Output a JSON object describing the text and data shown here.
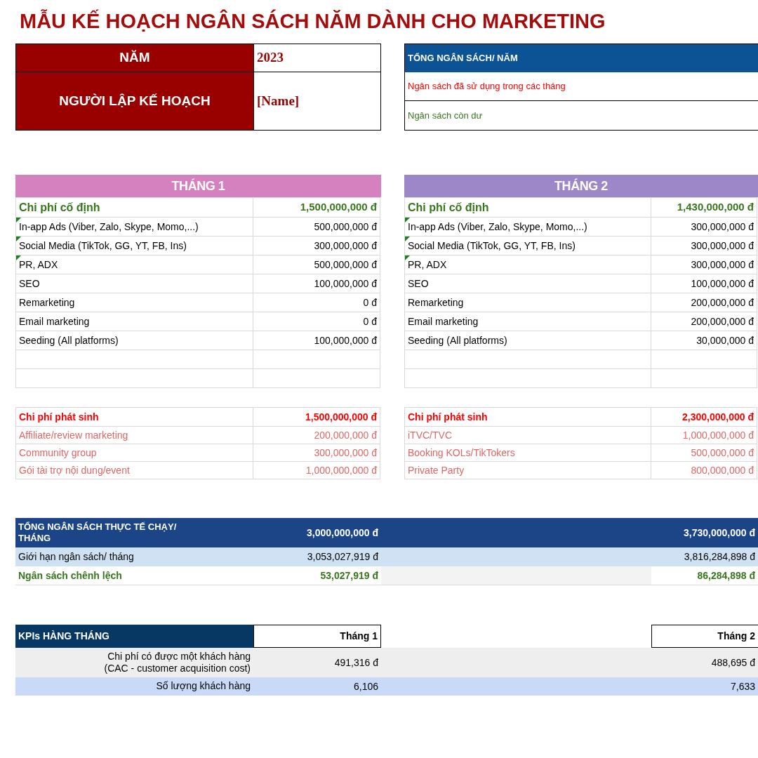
{
  "title": "MẪU KẾ HOẠCH NGÂN SÁCH NĂM DÀNH CHO MARKETING",
  "info": {
    "year_label": "NĂM",
    "year": "2023",
    "planner_label": "NGƯỜI LẬP KẾ HOẠCH",
    "planner": "[Name]"
  },
  "budget_summary": {
    "header": "TỔNG NGÂN SÁCH/ NĂM",
    "used_label": "Ngân sách đã sử dụng trong các tháng",
    "remaining_label": "Ngân sách còn dư"
  },
  "months": [
    {
      "title": "THÁNG 1",
      "color": "#d580bf",
      "fixed": {
        "label": "Chi phí cố định",
        "total": "1,500,000,000 đ",
        "items": [
          {
            "label": "In-app Ads (Viber, Zalo, Skype, Momo,...)",
            "amount": "500,000,000 đ",
            "comment": true
          },
          {
            "label": "Social Media (TikTok, GG, YT, FB, Ins)",
            "amount": "300,000,000 đ",
            "comment": true
          },
          {
            "label": "PR, ADX",
            "amount": "500,000,000 đ",
            "comment": true
          },
          {
            "label": "SEO",
            "amount": "100,000,000 đ",
            "comment": false
          },
          {
            "label": "Remarketing",
            "amount": "0 đ",
            "comment": false
          },
          {
            "label": "Email marketing",
            "amount": "0 đ",
            "comment": false
          },
          {
            "label": "Seeding (All platforms)",
            "amount": "100,000,000 đ",
            "comment": false
          }
        ]
      },
      "extra": {
        "label": "Chi phí phát sinh",
        "total": "1,500,000,000 đ",
        "items": [
          {
            "label": "Affiliate/review marketing",
            "amount": "200,000,000 đ"
          },
          {
            "label": "Community group",
            "amount": "300,000,000 đ"
          },
          {
            "label": "Gói tài trợ nội dung/event",
            "amount": "1,000,000,000 đ"
          }
        ]
      }
    },
    {
      "title": "THÁNG 2",
      "color": "#9d87c8",
      "fixed": {
        "label": "Chi phí cố định",
        "total": "1,430,000,000 đ",
        "items": [
          {
            "label": "In-app Ads (Viber, Zalo, Skype, Momo,...)",
            "amount": "300,000,000 đ",
            "comment": true
          },
          {
            "label": "Social Media (TikTok, GG, YT, FB, Ins)",
            "amount": "300,000,000 đ",
            "comment": true
          },
          {
            "label": "PR, ADX",
            "amount": "300,000,000 đ",
            "comment": true
          },
          {
            "label": "SEO",
            "amount": "100,000,000 đ",
            "comment": false
          },
          {
            "label": "Remarketing",
            "amount": "200,000,000 đ",
            "comment": false
          },
          {
            "label": "Email marketing",
            "amount": "200,000,000 đ",
            "comment": false
          },
          {
            "label": "Seeding (All platforms)",
            "amount": "30,000,000 đ",
            "comment": false
          }
        ]
      },
      "extra": {
        "label": "Chi phí phát sinh",
        "total": "2,300,000,000 đ",
        "items": [
          {
            "label": "iTVC/TVC",
            "amount": "1,000,000,000 đ"
          },
          {
            "label": "Booking KOLs/TikTokers",
            "amount": "500,000,000 đ"
          },
          {
            "label": "Private Party",
            "amount": "800,000,000 đ"
          }
        ]
      }
    }
  ],
  "totals": [
    {
      "kind": "total",
      "label": "TỔNG NGÂN SÁCH THỰC TẾ CHẠY/\nTHÁNG",
      "values": [
        "3,000,000,000 đ",
        "3,730,000,000 đ"
      ]
    },
    {
      "kind": "limit",
      "label": "Giới hạn ngân sách/ tháng",
      "values": [
        "3,053,027,919 đ",
        "3,816,284,898 đ"
      ]
    },
    {
      "kind": "difference",
      "label": "Ngân sách chênh lệch",
      "values": [
        "53,027,919 đ",
        "86,284,898 đ"
      ]
    }
  ],
  "kpis": {
    "header": "KPIs HÀNG THÁNG",
    "columns": [
      "Tháng 1",
      "Tháng 2"
    ],
    "rows": [
      {
        "label": "Chi phí có được một khách hàng\n(CAC - customer acquisition cost)",
        "values": [
          "491,316 đ",
          "488,695 đ"
        ]
      },
      {
        "label": "Số lượng khách hàng",
        "values": [
          "6,106",
          "7,633"
        ]
      }
    ]
  }
}
